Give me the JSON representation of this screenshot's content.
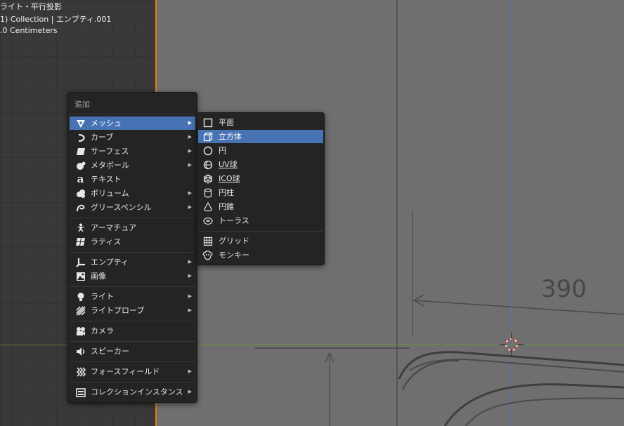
{
  "viewport": {
    "info_line1": "ライト・平行投影",
    "info_line2": "1) Collection | エンプティ.001",
    "info_line3": ".0 Centimeters",
    "dimension_label": "390"
  },
  "add_menu": {
    "title": "追加",
    "items": [
      {
        "label": "メッシュ",
        "icon": "mesh-icon",
        "submenu": true,
        "highlighted": true
      },
      {
        "label": "カーブ",
        "icon": "curve-icon",
        "submenu": true
      },
      {
        "label": "サーフェス",
        "icon": "surface-icon",
        "submenu": true
      },
      {
        "label": "メタボール",
        "icon": "metaball-icon",
        "submenu": true
      },
      {
        "label": "テキスト",
        "icon": "text-icon",
        "submenu": false
      },
      {
        "label": "ボリューム",
        "icon": "volume-icon",
        "submenu": true
      },
      {
        "label": "グリースペンシル",
        "icon": "grease-pencil-icon",
        "submenu": true
      },
      {
        "label": "アーマチュア",
        "icon": "armature-icon",
        "submenu": false
      },
      {
        "label": "ラティス",
        "icon": "lattice-icon",
        "submenu": false
      },
      {
        "label": "エンプティ",
        "icon": "empty-icon",
        "submenu": true
      },
      {
        "label": "画像",
        "icon": "image-icon",
        "submenu": true
      },
      {
        "label": "ライト",
        "icon": "light-icon",
        "submenu": true
      },
      {
        "label": "ライトプローブ",
        "icon": "light-probe-icon",
        "submenu": true
      },
      {
        "label": "カメラ",
        "icon": "camera-icon",
        "submenu": false
      },
      {
        "label": "スピーカー",
        "icon": "speaker-icon",
        "submenu": false
      },
      {
        "label": "フォースフィールド",
        "icon": "force-field-icon",
        "submenu": true
      },
      {
        "label": "コレクションインスタンス",
        "icon": "collection-instance-icon",
        "submenu": true
      }
    ]
  },
  "mesh_submenu": {
    "items": [
      {
        "label": "平面",
        "icon": "plane-icon"
      },
      {
        "label": "立方体",
        "icon": "cube-icon",
        "highlighted": true
      },
      {
        "label": "円",
        "icon": "circle-icon"
      },
      {
        "label": "UV球",
        "icon": "uv-sphere-icon"
      },
      {
        "label": "ICO球",
        "icon": "ico-sphere-icon"
      },
      {
        "label": "円柱",
        "icon": "cylinder-icon"
      },
      {
        "label": "円錐",
        "icon": "cone-icon"
      },
      {
        "label": "トーラス",
        "icon": "torus-icon"
      },
      {
        "label": "グリッド",
        "icon": "grid-icon"
      },
      {
        "label": "モンキー",
        "icon": "monkey-icon"
      }
    ]
  },
  "colors": {
    "accent_highlight": "#4772b3",
    "active_border": "#e07b16",
    "x_axis": "#6b8f3a",
    "y_axis": "#4a7bbf"
  }
}
